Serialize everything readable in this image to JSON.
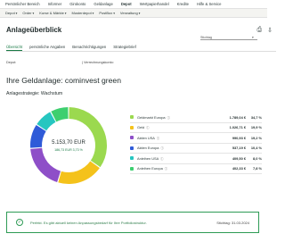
{
  "topnav": {
    "items": [
      "Persönlicher Bereich",
      "Informer",
      "Girokonto",
      "Geldanlage",
      "Depot",
      "Wertpapierhandel",
      "Kredite",
      "Hilfe & Service"
    ],
    "active_index": 4
  },
  "subnav": {
    "items": [
      "Depot",
      "Order",
      "Kurse & Märkte",
      "Musterdepot",
      "PostBox",
      "Verwaltung"
    ]
  },
  "header": {
    "title": "Anlageüberblick",
    "icons": [
      "printer-icon",
      "download-icon"
    ]
  },
  "stichtag_label": "Stichtag",
  "tabs": [
    "Übersicht",
    "persönliche Angaben",
    "Benachrichtigungen",
    "Strategiebrief"
  ],
  "active_tab": 0,
  "depot_label": "Depot:",
  "verrechnungskonto_label": "| Verrechnungskonto:",
  "main_title": "Ihre Geldanlage: cominvest green",
  "strategy_label": "Anlagestrategie: Wachstum",
  "center": {
    "value": "5.153,70 EUR",
    "performance": "186,73 EUR    3,73 %"
  },
  "legend": [
    {
      "name": "Geldmarkt Europa",
      "info": "ⓘ",
      "amount": "1.789,04 €",
      "pct": "34,7 %",
      "color": "#9bd94f"
    },
    {
      "name": "Geld",
      "info": "ⓘ",
      "amount": "1.026,71 €",
      "pct": "19,9 %",
      "color": "#f4c21b"
    },
    {
      "name": "Aktien USA",
      "info": "ⓘ",
      "amount": "990,93 €",
      "pct": "19,2 %",
      "color": "#8e4fc8"
    },
    {
      "name": "Aktien Europa",
      "info": "ⓘ",
      "amount": "537,19 €",
      "pct": "10,4 %",
      "color": "#2f5bd8"
    },
    {
      "name": "Anleihen USA",
      "info": "ⓘ",
      "amount": "409,50 €",
      "pct": "8,0 %",
      "color": "#26c6c0"
    },
    {
      "name": "Anleihen Europa",
      "info": "ⓘ",
      "amount": "402,33 €",
      "pct": "7,8 %",
      "color": "#3dcf6f"
    }
  ],
  "chart_data": {
    "type": "pie",
    "categories": [
      "Geldmarkt Europa",
      "Geld",
      "Aktien USA",
      "Aktien Europa",
      "Anleihen USA",
      "Anleihen Europa"
    ],
    "values": [
      34.7,
      19.9,
      19.2,
      10.4,
      8.0,
      7.8
    ],
    "colors": [
      "#9bd94f",
      "#f4c21b",
      "#8e4fc8",
      "#2f5bd8",
      "#26c6c0",
      "#3dcf6f"
    ]
  },
  "notice": {
    "text": "Perfekt. Es gibt aktuell keinen Anpassungsbedarf für Ihre Portfoliostruktur.",
    "date": "Stichtag: 31.03.2024",
    "check": "✓"
  }
}
